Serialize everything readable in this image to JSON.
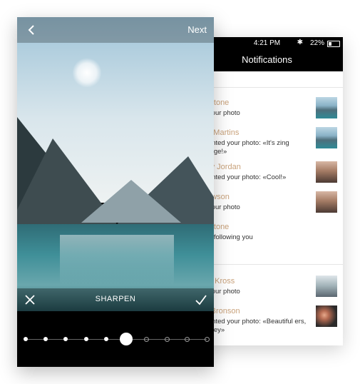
{
  "status_bar": {
    "time": "4:21 PM",
    "battery": "22%"
  },
  "notifications": {
    "title": "Notifications",
    "items": [
      {
        "name": "k Stone",
        "text": "d your photo",
        "thumb": "lake"
      },
      {
        "name": "be Martins",
        "text": "mented your photo: «It's zing bridge!»",
        "thumb": "lake"
      },
      {
        "name": "vey Jordan",
        "text": "mented your photo: «Cool!»",
        "thumb": "bridge"
      },
      {
        "name": " Lawson",
        "text": "d your photo",
        "thumb": "bridge"
      },
      {
        "name": "k Stone",
        "text": "ted following you",
        "thumb": ""
      },
      {
        "name": "ica Kross",
        "text": "d your photo",
        "thumb": "mount"
      },
      {
        "name": "ie Bronson",
        "text": "mented your photo: «Beautiful ers, honey»",
        "thumb": "flower"
      }
    ]
  },
  "editor": {
    "next_label": "Next",
    "tool_title": "SHARPEN",
    "slider_stops": 10,
    "slider_value_index": 5
  },
  "icons": {
    "back": "chevron-left-icon",
    "close": "close-icon",
    "confirm": "checkmark-icon",
    "bluetooth": "bluetooth-icon",
    "battery": "battery-icon"
  }
}
